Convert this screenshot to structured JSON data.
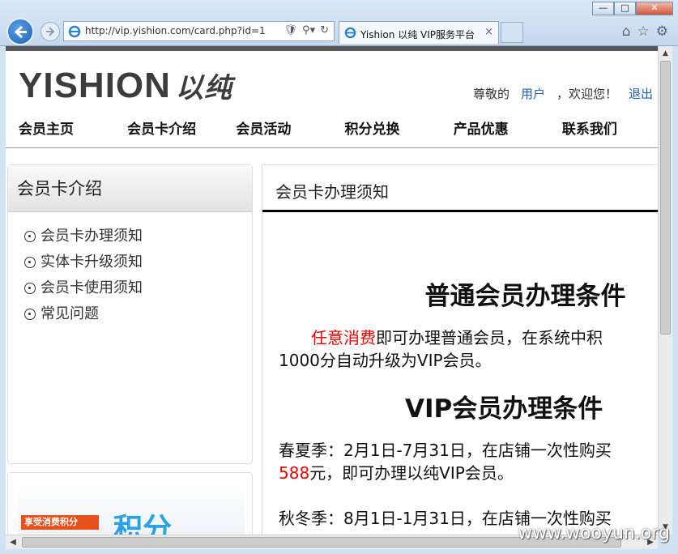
{
  "browser": {
    "url": "http://vip.yishion.com/card.php?id=1",
    "tab_title": "Yishion 以纯 VIP服务平台",
    "tab_close": "×",
    "window_min": "—",
    "window_max": "□",
    "window_close": "✕",
    "addr_tools": [
      "shield-icon",
      "search-icon",
      "refresh-icon"
    ],
    "right_icons": [
      "home-icon",
      "star-icon",
      "gear-icon"
    ]
  },
  "site": {
    "logo_latin": "YISHION",
    "logo_cn": "以纯",
    "greeting_prefix": "尊敬的",
    "user_link": "用户",
    "greeting_suffix": "，欢迎您！",
    "logout": "退出"
  },
  "nav": [
    "会员主页",
    "会员卡介绍",
    "会员活动",
    "积分兑换",
    "产品优惠",
    "联系我们"
  ],
  "sidebar": {
    "title": "会员卡介绍",
    "items": [
      "会员卡办理须知",
      "实体卡升级须知",
      "会员卡使用须知",
      "常见问题"
    ],
    "banner_text": "享受消费积分",
    "banner_big": "积分"
  },
  "content": {
    "header": "会员卡办理须知",
    "heading_normal": "普通会员办理条件",
    "para1_red": "任意消费",
    "para1_rest": "即可办理普通会员，在系统中积",
    "para1_line2": "1000分自动升级为VIP会员。",
    "heading_vip": "VIP会员办理条件",
    "para2_line1": "春夏季：2月1日-7月31日，在店铺一次性购买",
    "para2_red": "588",
    "para2_rest": "元，即可办理以纯VIP会员。",
    "para3_line1": "秋冬季：8月1日-1月31日，在店铺一次性购买"
  },
  "watermark": "www.wooyun.org"
}
